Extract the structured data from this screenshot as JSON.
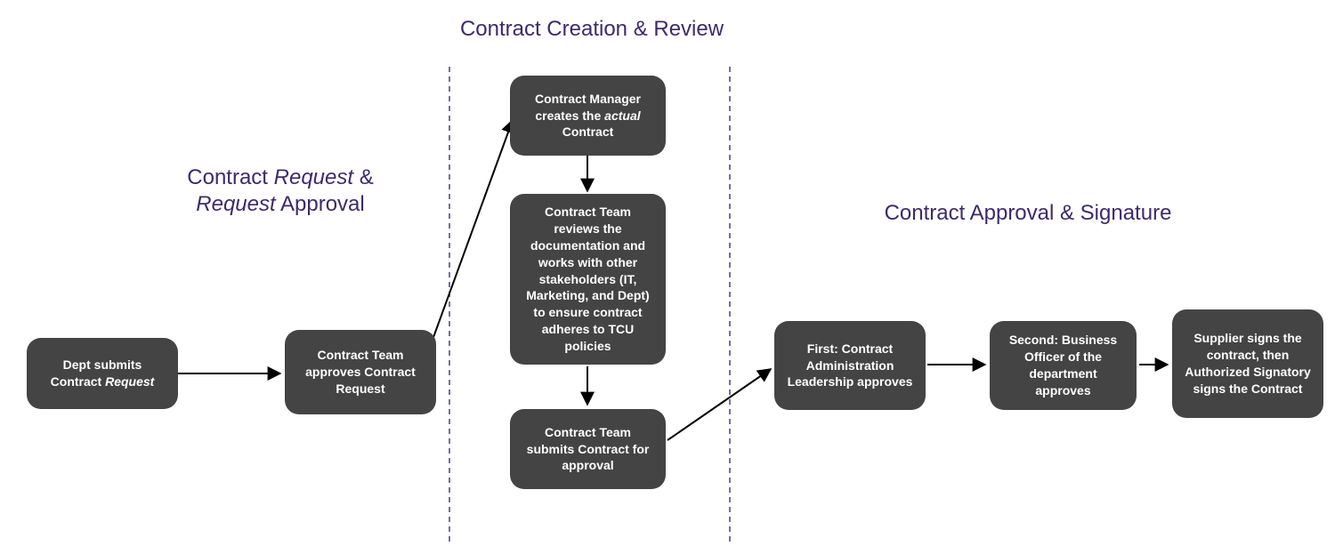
{
  "sections": {
    "request": {
      "title_pre": "Contract ",
      "title_ital1": "Request",
      "title_mid": " & ",
      "title_ital2": "Request",
      "title_post": " Approval"
    },
    "creation": {
      "title": "Contract Creation & Review"
    },
    "approval": {
      "title": "Contract Approval & Signature"
    }
  },
  "nodes": {
    "n1_pre": "Dept submits Contract ",
    "n1_ital": "Request",
    "n2": "Contract Team approves Contract Request",
    "n3_pre": "Contract Manager creates the ",
    "n3_ital": "actual",
    "n3_post": " Contract",
    "n4": "Contract Team reviews the documentation and works with other stakeholders (IT, Marketing, and Dept) to ensure contract adheres to TCU policies",
    "n5": "Contract Team submits Contract for approval",
    "n6": "First: Contract Administration Leadership approves",
    "n7": "Second: Business Officer of the department approves",
    "n8": "Supplier signs the contract, then Authorized Signatory signs the Contract"
  }
}
